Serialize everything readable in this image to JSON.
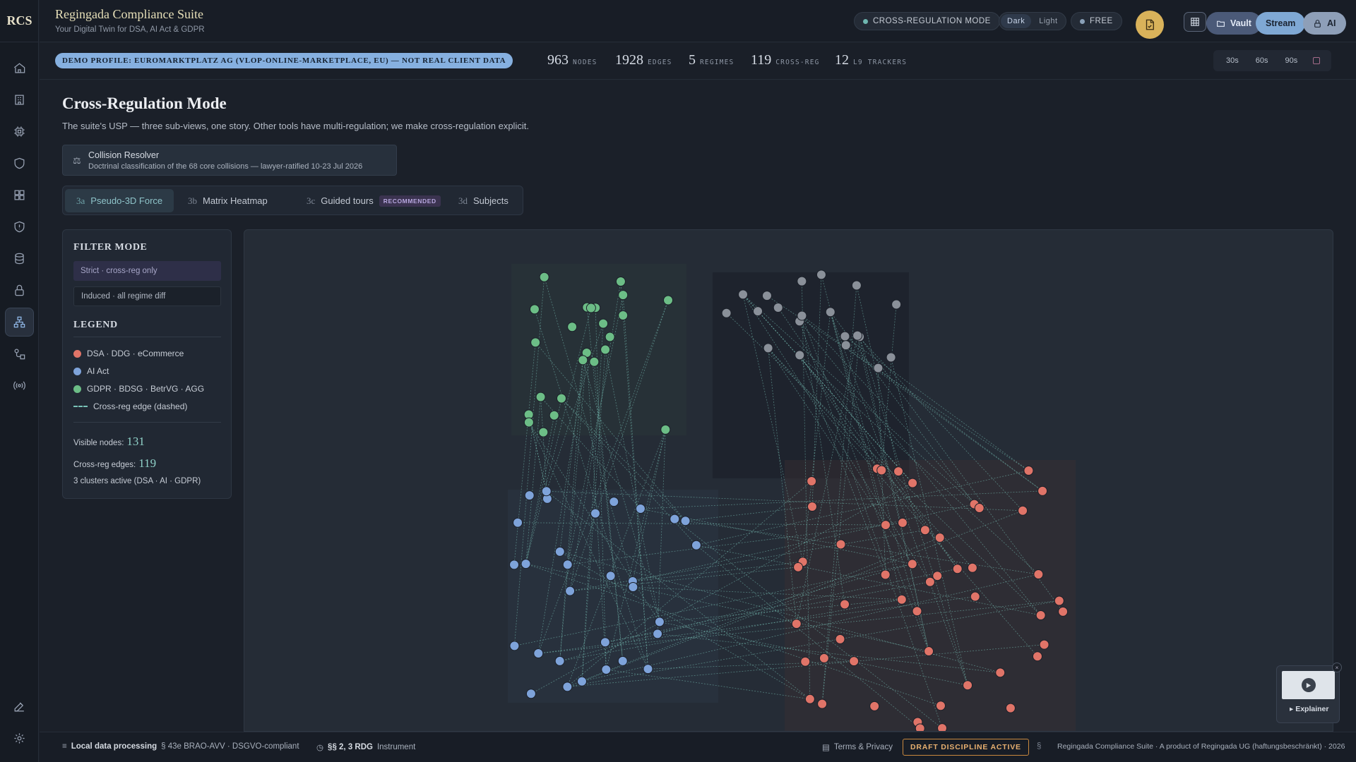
{
  "brand": "RCS",
  "header": {
    "title": "Regingada Compliance Suite",
    "subtitle": "Your Digital Twin for DSA, AI Act & GDPR",
    "mode_label": "CROSS-REGULATION MODE",
    "theme_dark": "Dark",
    "theme_light": "Light",
    "plan_label": "FREE",
    "vault_label": "Vault",
    "stream_label": "Stream",
    "ai_label": "AI"
  },
  "stats": {
    "demo_badge": "DEMO PROFILE: EUROMARKTPLATZ AG (VLOP-ONLINE-MARKETPLACE, EU) — NOT REAL CLIENT DATA",
    "nodes_num": "963",
    "nodes_label": "NODES",
    "edges_num": "1928",
    "edges_label": "EDGES",
    "regimes_num": "5",
    "regimes_label": "REGIMES",
    "crossreg_num": "119",
    "crossreg_label": "CROSS-REG",
    "trackers_num": "12",
    "trackers_label": "L9 TRACKERS",
    "time_options": [
      "30s",
      "60s",
      "90s"
    ]
  },
  "main": {
    "title": "Cross-Regulation Mode",
    "description": "The suite's USP — three sub-views, one story. Other tools have multi-regulation; we make cross-regulation explicit.",
    "resolver_title": "Collision Resolver",
    "resolver_sub": "Doctrinal classification of the 68 core collisions — lawyer-ratified 10-23 Jul 2026",
    "tabs": [
      {
        "key": "3a",
        "label": "Pseudo-3D Force"
      },
      {
        "key": "3b",
        "label": "Matrix Heatmap"
      },
      {
        "key": "3c",
        "label": "Guided tours",
        "badge": "RECOMMENDED"
      },
      {
        "key": "3d",
        "label": "Subjects"
      }
    ]
  },
  "filter": {
    "heading": "FILTER MODE",
    "strict": "Strict · cross-reg only",
    "induced": "Induced · all regime diff",
    "legend_heading": "LEGEND",
    "legend": [
      {
        "label": "DSA · DDG · eCommerce",
        "color": "#e07468"
      },
      {
        "label": "AI Act",
        "color": "#7ea3da"
      },
      {
        "label": "GDPR · BDSG · BetrVG · AGG",
        "color": "#6cbd86"
      }
    ],
    "legend_edge": "Cross-reg edge (dashed)",
    "visible_nodes_label": "Visible nodes:",
    "visible_nodes": "131",
    "crossreg_edges_label": "Cross-reg edges:",
    "crossreg_edges": "119",
    "clusters_text": "3 clusters active (DSA · AI · GDPR)"
  },
  "explainer": {
    "label": "Explainer",
    "close": "×"
  },
  "footer": {
    "local_processing": "Local data processing",
    "local_detail": "§ 43e BRAO-AVV · DSGVO-compliant",
    "rdg": "§§ 2, 3 RDG",
    "rdg_detail": "Instrument",
    "terms": "Terms & Privacy",
    "draft": "DRAFT DISCIPLINE ACTIVE",
    "section_mark": "§",
    "product": "Regingada Compliance Suite · A product of Regingada UG (haftungsbeschränkt) · 2026"
  },
  "colors": {
    "dsa": "#e07468",
    "ai": "#7ea3da",
    "gdpr": "#6cbd86",
    "edge": "#79c3b8",
    "mode_dot": "#6fb7b0"
  }
}
